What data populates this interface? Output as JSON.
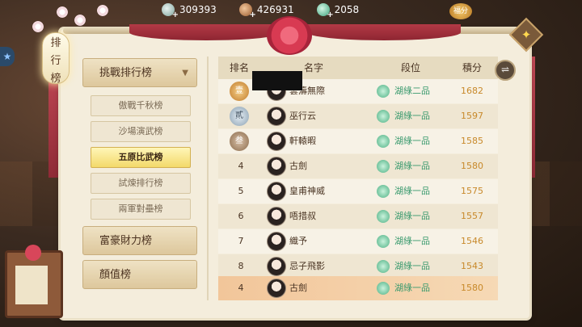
{
  "resources": [
    {
      "icon": "silver-coin-icon",
      "value": "309393"
    },
    {
      "icon": "copper-coin-icon",
      "value": "426931"
    },
    {
      "icon": "jade-coin-icon",
      "value": "2058"
    }
  ],
  "recharge_label": "福分",
  "plaque_title": [
    "排",
    "行",
    "榜"
  ],
  "menu": {
    "cat1": "挑戰排行榜",
    "subs": [
      "傲戰千秋榜",
      "沙場演武榜",
      "五原比武榜",
      "試煉排行榜",
      "兩軍對壘榜"
    ],
    "active_sub": "五原比武榜",
    "cat2": "富豪財力榜",
    "cat3": "顏值榜"
  },
  "table": {
    "headers": {
      "rank": "排名",
      "name": "名字",
      "tier": "段位",
      "score": "積分"
    },
    "rows": [
      {
        "rank": "壹",
        "name": "雲濤無際",
        "tier": "湖綠二品",
        "score": "1682",
        "medal": "gold"
      },
      {
        "rank": "貳",
        "name": "巫行云",
        "tier": "湖綠一品",
        "score": "1597",
        "medal": "silver"
      },
      {
        "rank": "叁",
        "name": "軒轅暇",
        "tier": "湖綠一品",
        "score": "1585",
        "medal": "bronze"
      },
      {
        "rank": "4",
        "name": "古劍",
        "tier": "湖綠一品",
        "score": "1580"
      },
      {
        "rank": "5",
        "name": "皇甫神威",
        "tier": "湖綠一品",
        "score": "1575"
      },
      {
        "rank": "6",
        "name": "唔措叔",
        "tier": "湖綠一品",
        "score": "1557"
      },
      {
        "rank": "7",
        "name": "織予",
        "tier": "湖綠一品",
        "score": "1546"
      },
      {
        "rank": "8",
        "name": "忌子飛影",
        "tier": "湖綠一品",
        "score": "1543"
      }
    ],
    "self_row": {
      "rank": "4",
      "name": "古劍",
      "tier": "湖綠一品",
      "score": "1580"
    }
  },
  "colors": {
    "accent_red": "#b33a46",
    "score_gold": "#c8892a",
    "tier_green": "#3a9a6e"
  }
}
